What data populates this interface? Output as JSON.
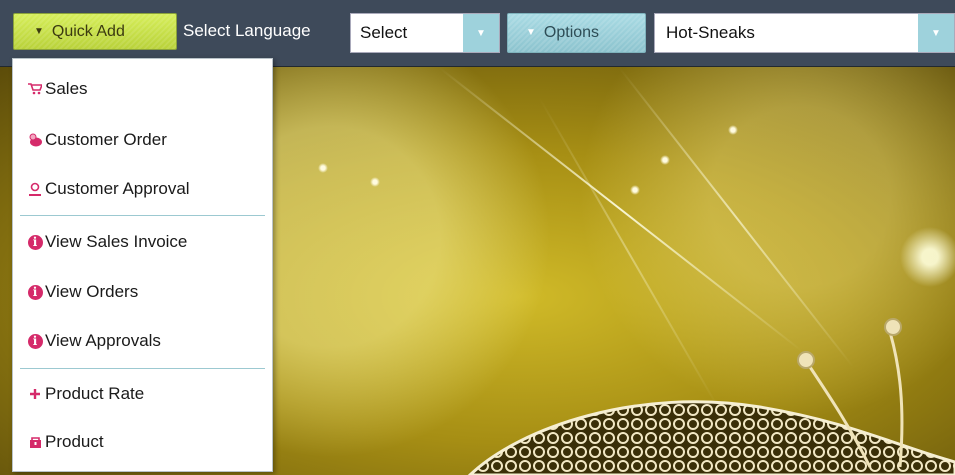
{
  "toolbar": {
    "quick_add_label": "Quick Add",
    "select_language_label": "Select Language",
    "language_select_value": "Select",
    "options_label": "Options",
    "store_select_value": "Hot-Sneaks"
  },
  "menu": {
    "items": [
      {
        "label": "Sales",
        "icon": "cart-icon"
      },
      {
        "label": "Customer Order",
        "icon": "order-icon"
      },
      {
        "label": "Customer Approval",
        "icon": "user-approval-icon"
      },
      {
        "label": "View Sales Invoice",
        "icon": "info-icon"
      },
      {
        "label": "View Orders",
        "icon": "info-icon"
      },
      {
        "label": "View Approvals",
        "icon": "info-icon"
      },
      {
        "label": "Product Rate",
        "icon": "plus-icon"
      },
      {
        "label": "Product",
        "icon": "product-icon"
      }
    ],
    "info_glyph": "i"
  },
  "colors": {
    "toolbar_bg": "#3e4a5a",
    "quick_add_bg": "#c8df48",
    "options_bg": "#9ed2dc",
    "menu_icon": "#d52a6a",
    "separator": "#9cc9d1"
  }
}
